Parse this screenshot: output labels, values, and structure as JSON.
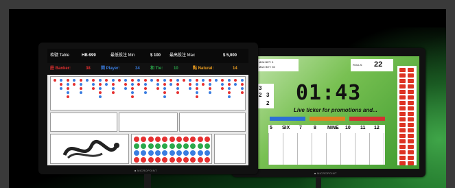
{
  "left_screen": {
    "header": {
      "table_label": "枱號 Table",
      "table_id": "HB-999",
      "min_label": "最低投注 Min",
      "min_value": "$ 100",
      "max_label": "最高投注 Max",
      "max_value": "$ 5,000"
    },
    "stats": {
      "banker_label": "莊 Banker:",
      "banker_count": "38",
      "player_label": "閑 Player:",
      "player_count": "34",
      "tie_label": "和 Tie:",
      "tie_count": "10",
      "natural_label": "點 Natural:",
      "natural_count": "14"
    },
    "brand": "■ MICROPOINT"
  },
  "right_screen": {
    "info": {
      "min_bet_label": "MINI BET:",
      "min_bet_value": "5",
      "max_bet_label": "MAX BET:",
      "max_bet_value": "50",
      "rolls_label": "ROLLS:",
      "rolls_value": "22"
    },
    "side_numbers": [
      "3",
      "2",
      "3",
      "2"
    ],
    "timer": "01:43",
    "ticker": "Live ticker for promotions and...",
    "number_row": [
      "5",
      "SIX",
      "7",
      "8",
      "NINE",
      "10",
      "11",
      "12"
    ],
    "brand": "■ MICROPOINT"
  },
  "colors": {
    "banker": "#e53030",
    "player": "#3a7de0",
    "tie": "#2aa84a",
    "natural": "#f0a020",
    "accent_green": "#3d9a2e"
  }
}
